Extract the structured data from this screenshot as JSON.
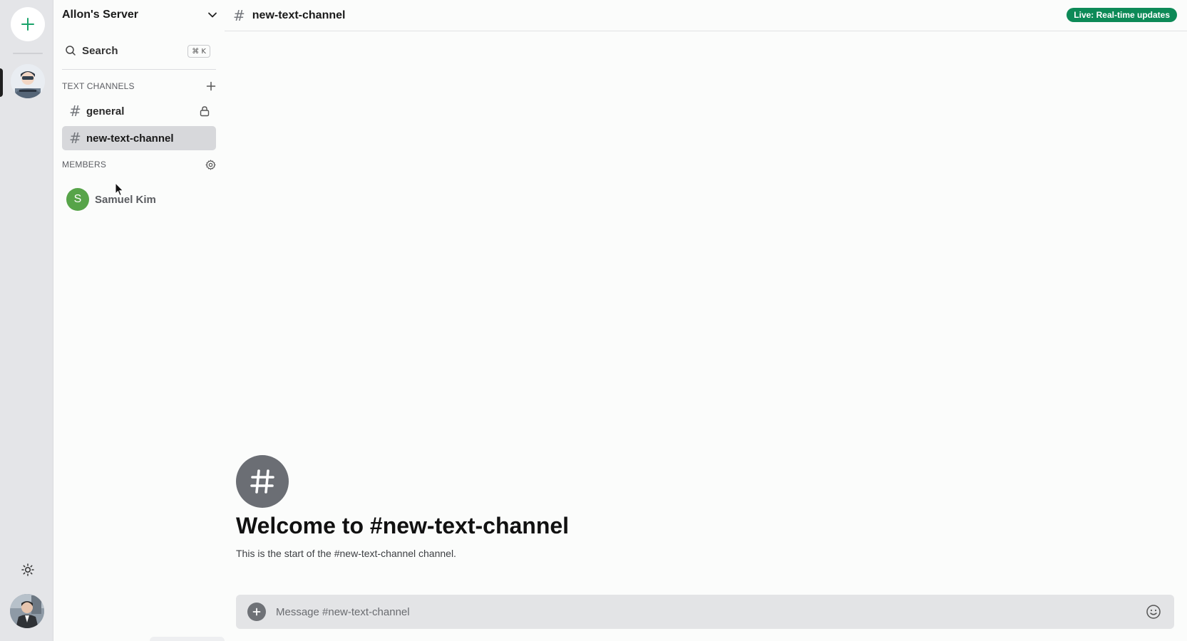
{
  "app": {
    "server_name": "Allon's Server",
    "search": {
      "label": "Search",
      "shortcut": "⌘ K"
    },
    "sections": {
      "text_channels": "TEXT CHANNELS",
      "members": "MEMBERS"
    },
    "channels": [
      {
        "name": "general",
        "locked": true,
        "active": false
      },
      {
        "name": "new-text-channel",
        "locked": false,
        "active": true
      }
    ],
    "members": [
      {
        "initial": "S",
        "name": "Samuel Kim",
        "avatar_color": "#57a449"
      }
    ]
  },
  "header": {
    "channel_name": "new-text-channel",
    "live_badge": "Live: Real-time updates"
  },
  "welcome": {
    "title": "Welcome to #new-text-channel",
    "subtitle": "This is the start of the #new-text-channel channel."
  },
  "composer": {
    "placeholder": "Message #new-text-channel"
  },
  "colors": {
    "accent_green": "#0d8a57",
    "add_plus": "#1aa36a",
    "active_channel_bg": "#d7d8db"
  },
  "icons": {
    "rail_add": "plus-icon",
    "theme": "sun-icon",
    "search": "search-icon",
    "dropdown": "chevron-down-icon",
    "add_channel": "plus-icon",
    "lock": "lock-icon",
    "settings": "gear-icon",
    "composer_add": "plus-circle-icon",
    "emoji": "smile-icon"
  }
}
